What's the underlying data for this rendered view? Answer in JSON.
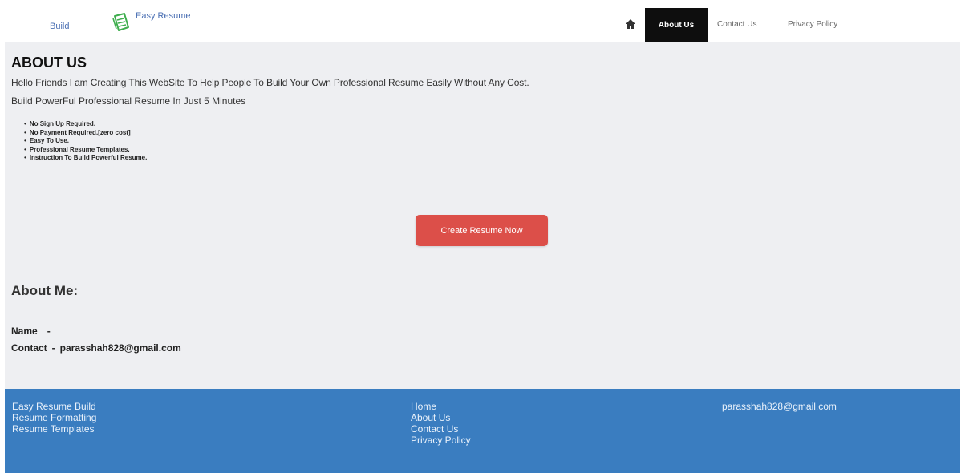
{
  "navbar": {
    "brand_build": "Build",
    "brand_name": "Easy Resume",
    "home_icon": "home-icon",
    "links": [
      "About Us",
      "Contact Us",
      "Privacy Policy"
    ],
    "active": "About Us"
  },
  "about": {
    "title": "ABOUT US",
    "intro": "Hello Friends I am Creating This WebSite To Help People To Build Your Own Professional Resume Easily Without Any Cost.",
    "tagline": "Build PowerFul Professional Resume In Just 5 Minutes",
    "features": [
      "No Sign Up Required.",
      "No Payment Required.[zero cost]",
      "Easy To Use.",
      "Professional Resume Templates.",
      "Instruction To Build Powerful Resume."
    ],
    "cta_label": "Create Resume Now"
  },
  "about_me": {
    "heading": "About Me:",
    "name_label": "Name",
    "name_sep": "-",
    "name_value": "",
    "contact_label": "Contact",
    "contact_sep": "-",
    "contact_value": "parasshah828@gmail.com"
  },
  "footer": {
    "col1": [
      "Easy Resume Build",
      "Resume Formatting",
      "Resume Templates"
    ],
    "col2": [
      "Home",
      "About Us",
      "Contact Us",
      "Privacy Policy"
    ],
    "email": "parasshah828@gmail.com"
  },
  "colors": {
    "background": "#eeeff2",
    "nav_active": "#0e0e0e",
    "cta": "#dc4f49",
    "footer": "#3a7dc0",
    "brand": "#4a6fb3"
  }
}
